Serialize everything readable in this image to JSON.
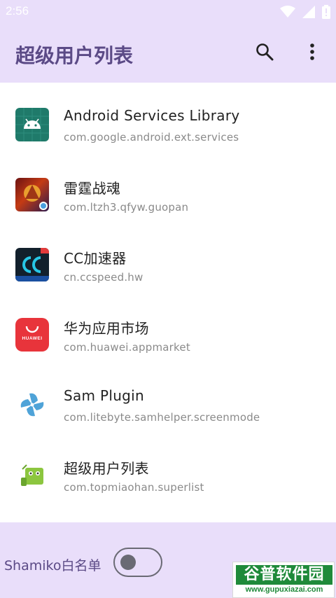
{
  "status_bar": {
    "time": "2:56",
    "icons": [
      "wifi-icon",
      "signal-icon",
      "battery-icon"
    ]
  },
  "app_bar": {
    "title": "超级用户列表",
    "actions": [
      "search-icon",
      "more-vert-icon"
    ]
  },
  "apps": [
    {
      "name": "Android Services Library",
      "package": "com.google.android.ext.services",
      "icon": "android-icon"
    },
    {
      "name": "雷霆战魂",
      "package": "com.ltzh3.qfyw.guopan",
      "icon": "game-icon"
    },
    {
      "name": "CC加速器",
      "package": "cn.ccspeed.hw",
      "icon": "cc-accelerator-icon"
    },
    {
      "name": "华为应用市场",
      "package": "com.huawei.appmarket",
      "icon": "huawei-appgallery-icon"
    },
    {
      "name": "Sam Plugin",
      "package": "com.litebyte.samhelper.screenmode",
      "icon": "pinwheel-icon"
    },
    {
      "name": "超级用户列表",
      "package": "com.topmiaohan.superlist",
      "icon": "superlist-icon"
    }
  ],
  "bottom": {
    "whitelist_label": "Shamiko白名单",
    "toggle_on": false
  },
  "watermark": {
    "title": "谷普软件园",
    "url": "www.gupuxiazai.com"
  },
  "colors": {
    "bar_bg": "#e9defa",
    "accent_text": "#5b4a86",
    "watermark_green": "#1f8a3a"
  }
}
